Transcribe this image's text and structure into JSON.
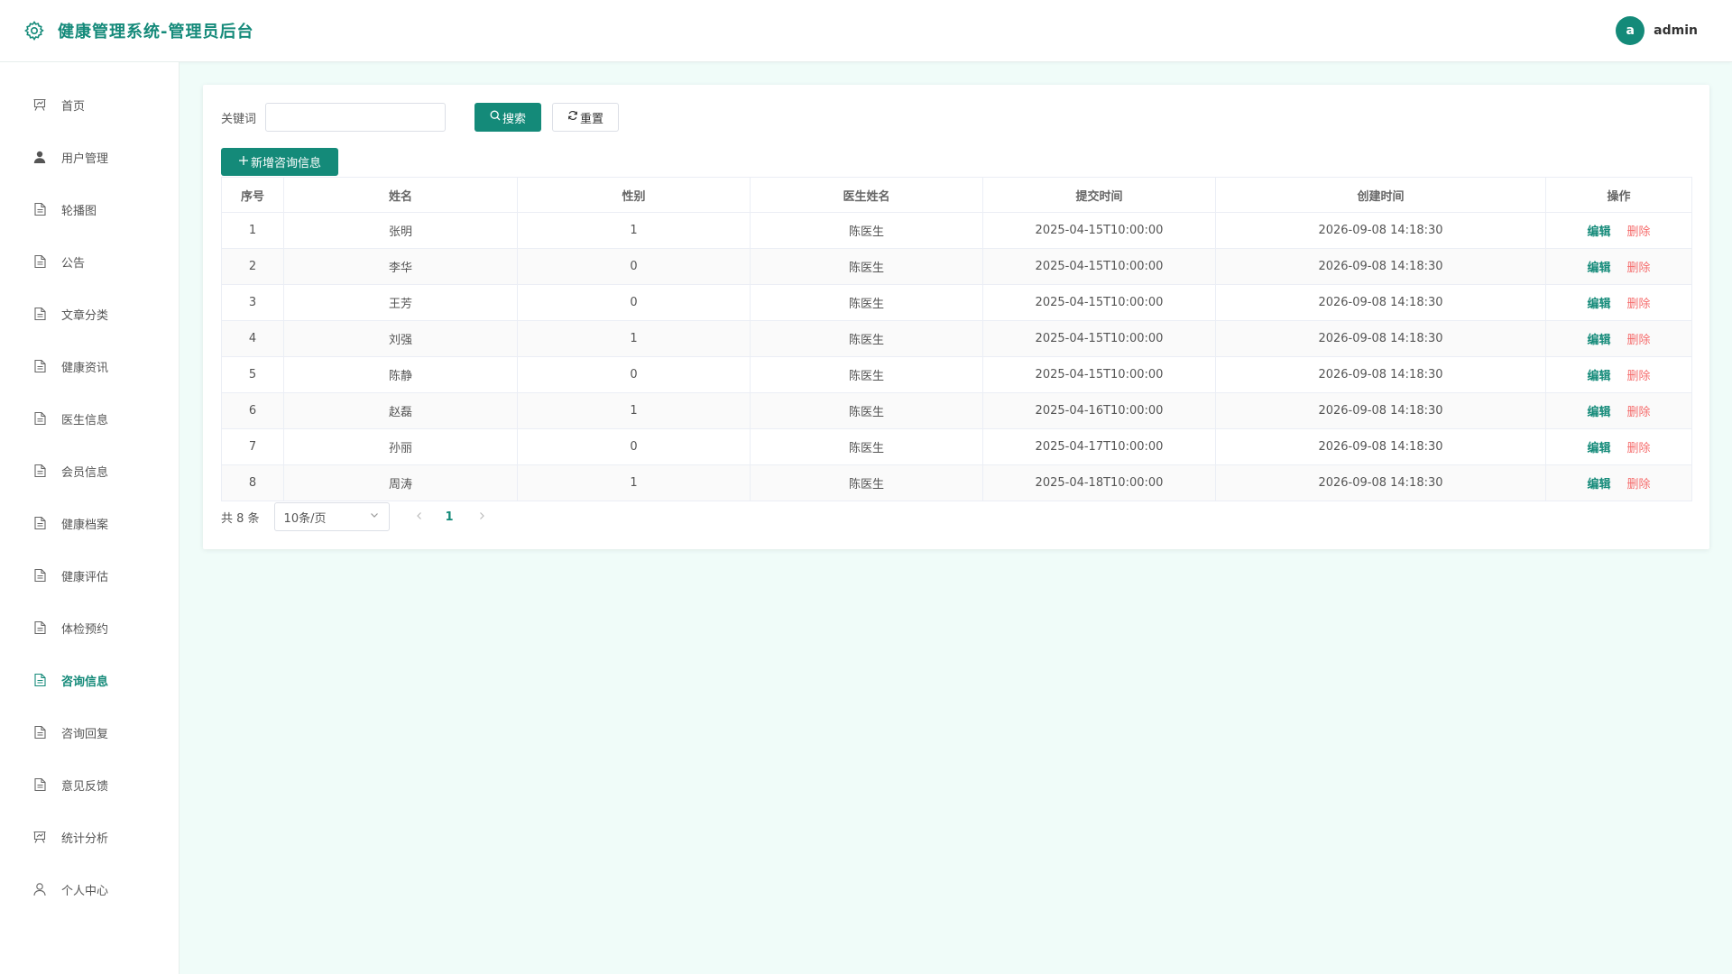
{
  "header": {
    "title": "健康管理系统-管理员后台",
    "avatar_letter": "a",
    "username": "admin"
  },
  "sidebar": {
    "items": [
      {
        "label": "首页",
        "icon": "presentation-icon",
        "active": false
      },
      {
        "label": "用户管理",
        "icon": "user-filled-icon",
        "active": false
      },
      {
        "label": "轮播图",
        "icon": "document-icon",
        "active": false
      },
      {
        "label": "公告",
        "icon": "document-icon",
        "active": false
      },
      {
        "label": "文章分类",
        "icon": "document-icon",
        "active": false
      },
      {
        "label": "健康资讯",
        "icon": "document-icon",
        "active": false
      },
      {
        "label": "医生信息",
        "icon": "document-icon",
        "active": false
      },
      {
        "label": "会员信息",
        "icon": "document-icon",
        "active": false
      },
      {
        "label": "健康档案",
        "icon": "document-icon",
        "active": false
      },
      {
        "label": "健康评估",
        "icon": "document-icon",
        "active": false
      },
      {
        "label": "体检预约",
        "icon": "document-icon",
        "active": false
      },
      {
        "label": "咨询信息",
        "icon": "document-icon",
        "active": true
      },
      {
        "label": "咨询回复",
        "icon": "document-icon",
        "active": false
      },
      {
        "label": "意见反馈",
        "icon": "document-icon",
        "active": false
      },
      {
        "label": "统计分析",
        "icon": "presentation-icon",
        "active": false
      },
      {
        "label": "个人中心",
        "icon": "user-outline-icon",
        "active": false
      }
    ]
  },
  "search": {
    "label": "关键词",
    "value": "",
    "placeholder": "",
    "search_button": "搜索",
    "reset_button": "重置"
  },
  "toolbar": {
    "add_button": "新增咨询信息"
  },
  "table": {
    "columns": [
      "序号",
      "姓名",
      "性别",
      "医生姓名",
      "提交时间",
      "创建时间",
      "操作"
    ],
    "edit_label": "编辑",
    "delete_label": "删除",
    "rows": [
      [
        "1",
        "张明",
        "1",
        "陈医生",
        "2025-04-15T10:00:00",
        "2026-09-08 14:18:30"
      ],
      [
        "2",
        "李华",
        "0",
        "陈医生",
        "2025-04-15T10:00:00",
        "2026-09-08 14:18:30"
      ],
      [
        "3",
        "王芳",
        "0",
        "陈医生",
        "2025-04-15T10:00:00",
        "2026-09-08 14:18:30"
      ],
      [
        "4",
        "刘强",
        "1",
        "陈医生",
        "2025-04-15T10:00:00",
        "2026-09-08 14:18:30"
      ],
      [
        "5",
        "陈静",
        "0",
        "陈医生",
        "2025-04-15T10:00:00",
        "2026-09-08 14:18:30"
      ],
      [
        "6",
        "赵磊",
        "1",
        "陈医生",
        "2025-04-16T10:00:00",
        "2026-09-08 14:18:30"
      ],
      [
        "7",
        "孙丽",
        "0",
        "陈医生",
        "2025-04-17T10:00:00",
        "2026-09-08 14:18:30"
      ],
      [
        "8",
        "周涛",
        "1",
        "陈医生",
        "2025-04-18T10:00:00",
        "2026-09-08 14:18:30"
      ]
    ]
  },
  "pagination": {
    "total_text": "共 8 条",
    "page_size": "10条/页",
    "current_page": "1"
  },
  "colors": {
    "accent": "#148a79",
    "danger": "#f56c6c",
    "background": "#f0fcf9"
  }
}
